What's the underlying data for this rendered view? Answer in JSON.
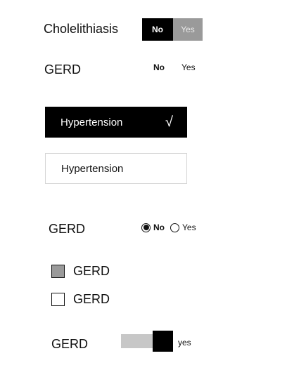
{
  "row1": {
    "label": "Cholelithiasis",
    "no": "No",
    "yes": "Yes",
    "selected": "No"
  },
  "row2": {
    "label": "GERD",
    "no": "No",
    "yes": "Yes",
    "selected": "No"
  },
  "hypertension_selected": {
    "label": "Hypertension",
    "check": "√"
  },
  "hypertension_unselected": {
    "label": "Hypertension"
  },
  "row_radio": {
    "label": "GERD",
    "no": "No",
    "yes": "Yes",
    "selected": "No"
  },
  "checkbox_checked": {
    "label": "GERD",
    "checked": true
  },
  "checkbox_unchecked": {
    "label": "GERD",
    "checked": false
  },
  "row_switch": {
    "label": "GERD",
    "yes": "yes",
    "on": true
  }
}
